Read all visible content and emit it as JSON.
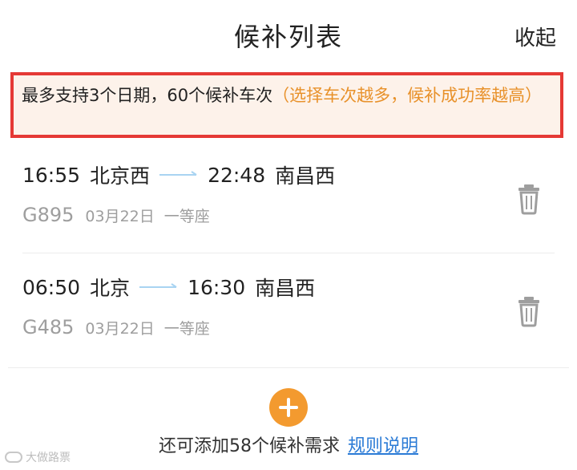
{
  "header": {
    "title": "候补列表",
    "collapse_label": "收起"
  },
  "notice": {
    "main_text": "最多支持3个日期，60个候补车次",
    "hint_text": "（选择车次越多，候补成功率越高）"
  },
  "trains": [
    {
      "dep_time": "16:55",
      "dep_station": "北京西",
      "arr_time": "22:48",
      "arr_station": "南昌西",
      "train_no": "G895",
      "date": "03月22日",
      "seat": "一等座"
    },
    {
      "dep_time": "06:50",
      "dep_station": "北京",
      "arr_time": "16:30",
      "arr_station": "南昌西",
      "train_no": "G485",
      "date": "03月22日",
      "seat": "一等座"
    }
  ],
  "footer": {
    "remaining_text": "还可添加58个候补需求",
    "rules_link": "规则说明"
  },
  "watermark": {
    "text": "大做路票"
  },
  "colors": {
    "accent": "#f39a2f",
    "hint": "#e8912a",
    "link": "#2b7bd6",
    "highlight_border": "#e53935"
  },
  "icons": {
    "trash": "trash-icon",
    "add": "plus-icon",
    "arrow": "arrow-right-icon"
  }
}
